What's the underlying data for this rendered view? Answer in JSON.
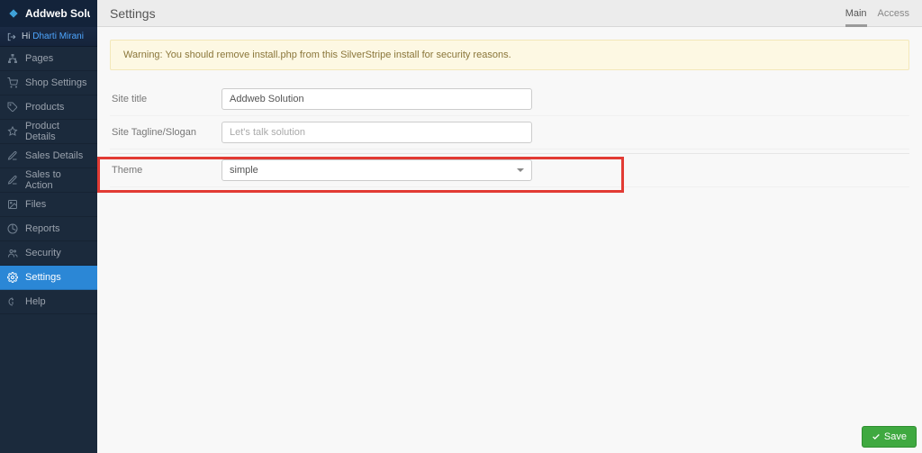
{
  "brand": "Addweb Solution",
  "greeting": {
    "prefix": "Hi",
    "username": "Dharti Mirani"
  },
  "sidebar": {
    "items": [
      {
        "label": "Pages"
      },
      {
        "label": "Shop Settings"
      },
      {
        "label": "Products"
      },
      {
        "label": "Product Details"
      },
      {
        "label": "Sales Details"
      },
      {
        "label": "Sales to Action"
      },
      {
        "label": "Files"
      },
      {
        "label": "Reports"
      },
      {
        "label": "Security"
      },
      {
        "label": "Settings"
      },
      {
        "label": "Help"
      }
    ]
  },
  "header": {
    "title": "Settings",
    "tabs": [
      {
        "label": "Main"
      },
      {
        "label": "Access"
      }
    ]
  },
  "alert": "Warning: You should remove install.php from this SilverStripe install for security reasons.",
  "form": {
    "site_title": {
      "label": "Site title",
      "value": "Addweb Solution"
    },
    "tagline": {
      "label": "Site Tagline/Slogan",
      "placeholder": "Let's talk solution"
    },
    "theme": {
      "label": "Theme",
      "selected": "simple"
    }
  },
  "actions": {
    "save": "Save"
  }
}
